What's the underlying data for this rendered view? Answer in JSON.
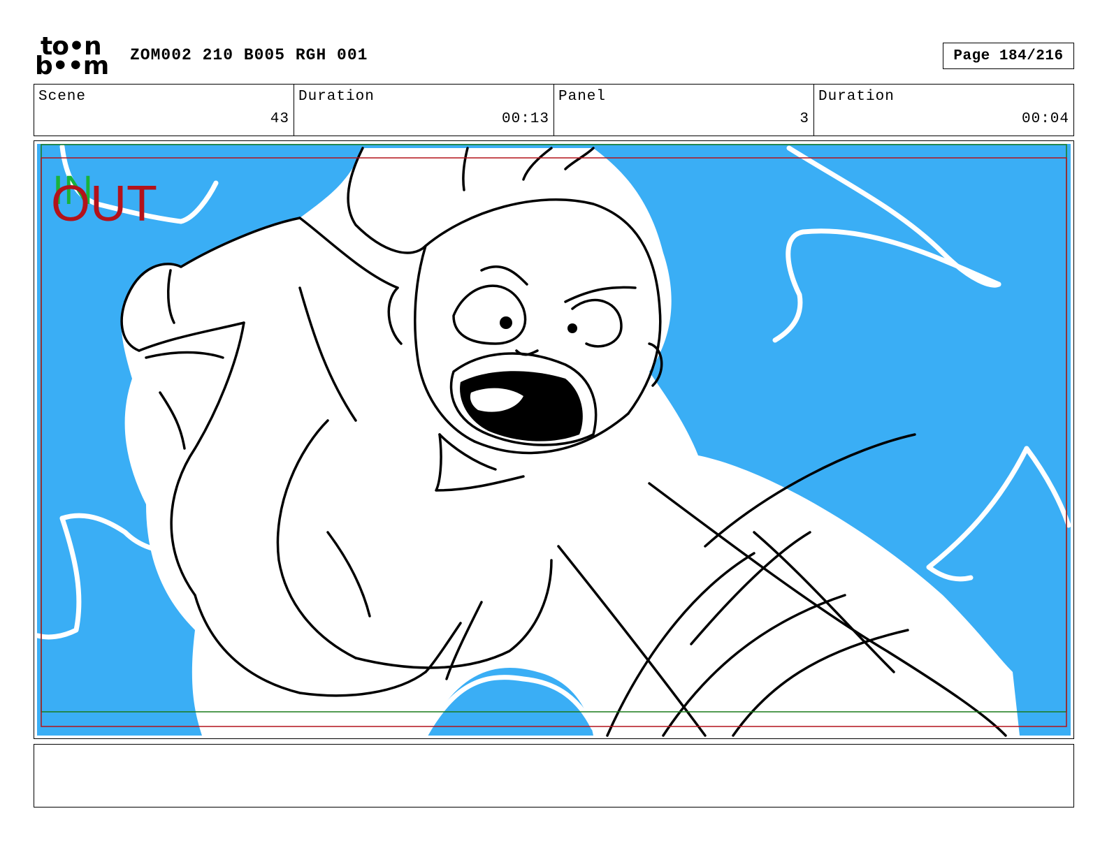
{
  "header": {
    "logo_text_top": "to•n",
    "logo_text_bottom": "b••m",
    "document_title": "ZOM002 210 B005 RGH 001",
    "page_label": "Page 184/216"
  },
  "info": {
    "scene_label": "Scene",
    "scene_value": "43",
    "scene_duration_label": "Duration",
    "scene_duration_value": "00:13",
    "panel_label": "Panel",
    "panel_value": "3",
    "panel_duration_label": "Duration",
    "panel_duration_value": "00:04"
  },
  "panel_image": {
    "in_marker": "IN",
    "out_marker": "OUT",
    "sky_color": "#3aaef5",
    "in_color": "#19b23a",
    "out_color": "#b3121a",
    "safe_frame_color": "#1a7a1a",
    "title_frame_color": "#b3121a"
  },
  "notes": {
    "text": ""
  }
}
